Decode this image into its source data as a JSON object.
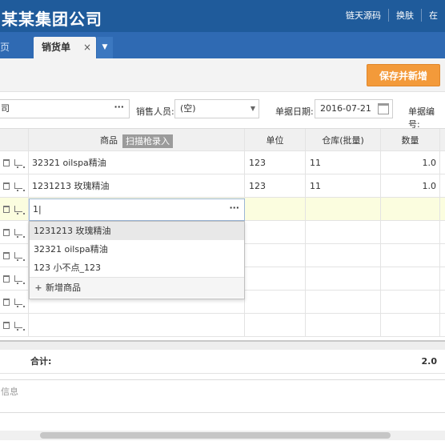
{
  "header": {
    "brand": "某某集团公司",
    "links": [
      "链天源码",
      "换肤",
      "在"
    ]
  },
  "tabs": {
    "home": "首页",
    "active": "销货单",
    "close": "×",
    "more": "▼"
  },
  "toolbar": {
    "save_new": "保存并新增"
  },
  "form": {
    "customer_value": "司",
    "customer_dots": "···",
    "sales_label": "销售人员:",
    "sales_value": "(空)",
    "date_label": "单据日期:",
    "date_value": "2016-07-21",
    "number_label": "单据编号:"
  },
  "grid": {
    "columns": {
      "product": "商品",
      "scan": "扫描枪录入",
      "unit": "单位",
      "warehouse": "仓库(批量)",
      "quantity": "数量"
    },
    "rows": [
      {
        "product": "32321 oilspa精油",
        "unit": "123",
        "warehouse": "11",
        "quantity": "1.0"
      },
      {
        "product": "1231213 玫瑰精油",
        "unit": "123",
        "warehouse": "11",
        "quantity": "1.0"
      }
    ],
    "edit_value": "1|",
    "edit_dots": "···"
  },
  "dropdown": {
    "items": [
      "1231213 玫瑰精油",
      "32321 oilspa精油",
      "123 小不点_123"
    ],
    "add": "新增商品"
  },
  "totals": {
    "label": "合计:",
    "quantity": "2.0"
  },
  "notes": {
    "label": "信息"
  }
}
